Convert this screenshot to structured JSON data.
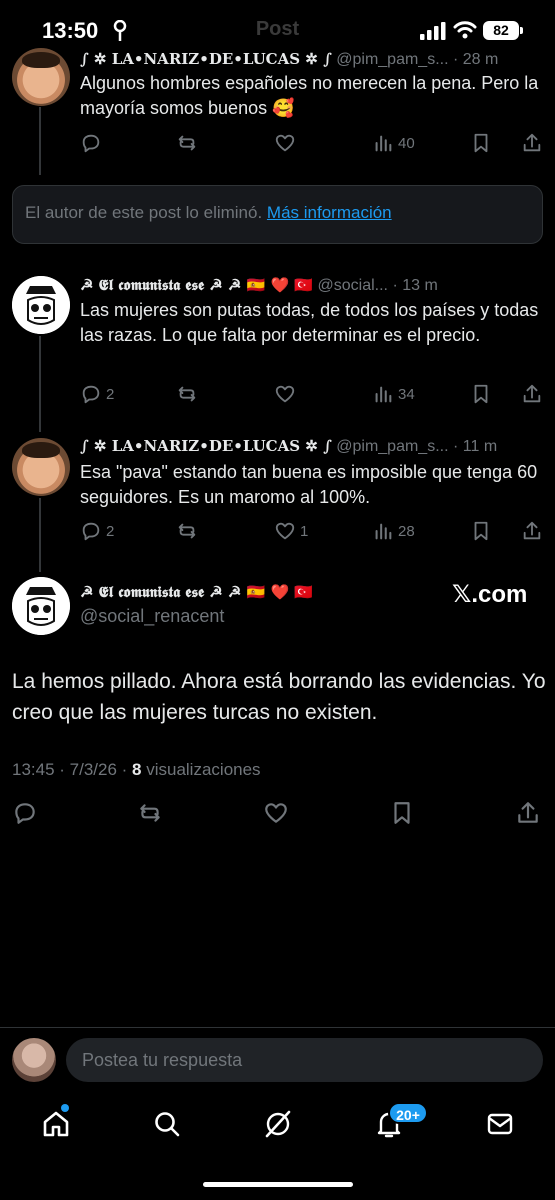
{
  "status_bar": {
    "time": "13:50",
    "ghost_title": "Post",
    "battery": "82"
  },
  "post1": {
    "name": "∫ ✲ LA•NARIZ•DE•LUCAS ✲ ∫",
    "handle": "@pim_pam_s...",
    "time": "· 28 m",
    "text": "Algunos hombres españoles no merecen la pena. Pero la mayoría somos buenos 🥰",
    "views": "40"
  },
  "deleted_notice": {
    "text": "El autor de este post lo eliminó.",
    "link": "Más información"
  },
  "post2": {
    "name": "☭ 𝕰𝖑 𝖈𝖔𝖒𝖚𝖓𝖎𝖘𝖙𝖆 𝖊𝖘𝖊 ☭ ☭ 🇪🇸 ❤️ 🇹🇷",
    "handle": "@social...",
    "time": "· 13 m",
    "text": "Las mujeres son putas todas, de todos los países y todas las razas. Lo que falta por determinar es el precio.",
    "replies": "2",
    "views": "34"
  },
  "post3": {
    "name": "∫ ✲ LA•NARIZ•DE•LUCAS ✲ ∫",
    "handle": "@pim_pam_s...",
    "time": "· 11 m",
    "text": "Esa \"pava\" estando tan buena es imposible que tenga 60 seguidores. Es un maromo al 100%.",
    "replies": "2",
    "likes": "1",
    "views": "28"
  },
  "main_post": {
    "name": "☭ 𝕰𝖑 𝖈𝖔𝖒𝖚𝖓𝖎𝖘𝖙𝖆 𝖊𝖘𝖊 ☭ ☭ 🇪🇸 ❤️ 🇹🇷",
    "handle": "@social_renacent",
    "watermark": "𝕏.com",
    "text": "La hemos pillado. Ahora está borrando las evidencias. Yo creo que las mujeres turcas no existen.",
    "date": "13:45 · 7/3/26 · ",
    "views_count": "8",
    "views_label": " visualizaciones"
  },
  "reply": {
    "placeholder": "Postea tu respuesta"
  },
  "tabbar": {
    "notifications_badge": "20+"
  },
  "colors": {
    "accent": "#1d9bf0",
    "background": "#000000",
    "muted": "#71767b"
  }
}
